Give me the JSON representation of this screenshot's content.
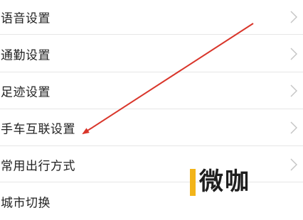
{
  "settings": {
    "items": [
      {
        "label": "语音设置"
      },
      {
        "label": "通勤设置"
      },
      {
        "label": "足迹设置"
      },
      {
        "label": "手车互联设置"
      },
      {
        "label": "常用出行方式"
      },
      {
        "label": "城市切换"
      }
    ]
  },
  "annotation": {
    "arrow_color": "#d9362b"
  },
  "watermark": {
    "text": "微咖",
    "accent_color": "#f2b419"
  }
}
